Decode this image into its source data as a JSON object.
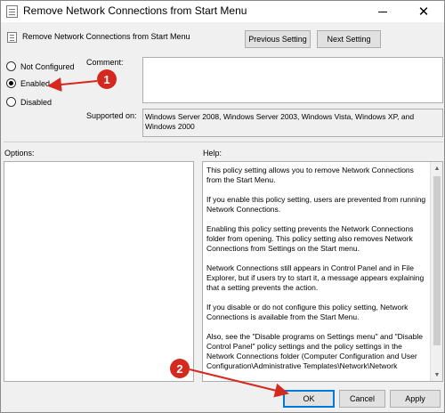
{
  "window": {
    "title": "Remove Network Connections from Start Menu",
    "minimize_icon": "minimize-icon",
    "close_glyph": "✕"
  },
  "header": {
    "policy_name": "Remove Network Connections from Start Menu",
    "previous_label": "Previous Setting",
    "next_label": "Next Setting"
  },
  "state": {
    "options": [
      {
        "label": "Not Configured",
        "checked": false
      },
      {
        "label": "Enabled",
        "checked": true
      },
      {
        "label": "Disabled",
        "checked": false
      }
    ]
  },
  "comment": {
    "label": "Comment:",
    "value": ""
  },
  "supported": {
    "label": "Supported on:",
    "value": "Windows Server 2008, Windows Server 2003, Windows Vista, Windows XP, and Windows 2000"
  },
  "options_panel": {
    "label": "Options:"
  },
  "help_panel": {
    "label": "Help:",
    "paragraphs": [
      "This policy setting allows you to remove Network Connections from the Start Menu.",
      "If you enable this policy setting, users are prevented from running Network Connections.",
      "Enabling this policy setting prevents the Network Connections folder from opening. This policy setting also removes Network Connections from Settings on the Start menu.",
      "Network Connections still appears in Control Panel and in File Explorer, but if users try to start it, a message appears explaining that a setting prevents the action.",
      "If you disable or do not configure this policy setting, Network Connections is available from the Start Menu.",
      "Also, see the \"Disable programs on Settings menu\" and \"Disable Control Panel\" policy settings and the policy settings in the Network Connections folder (Computer Configuration and User Configuration\\Administrative Templates\\Network\\Network"
    ]
  },
  "footer": {
    "ok_label": "OK",
    "cancel_label": "Cancel",
    "apply_label": "Apply"
  },
  "annotations": {
    "callout_1": "1",
    "callout_2": "2",
    "color": "#d5281f"
  }
}
